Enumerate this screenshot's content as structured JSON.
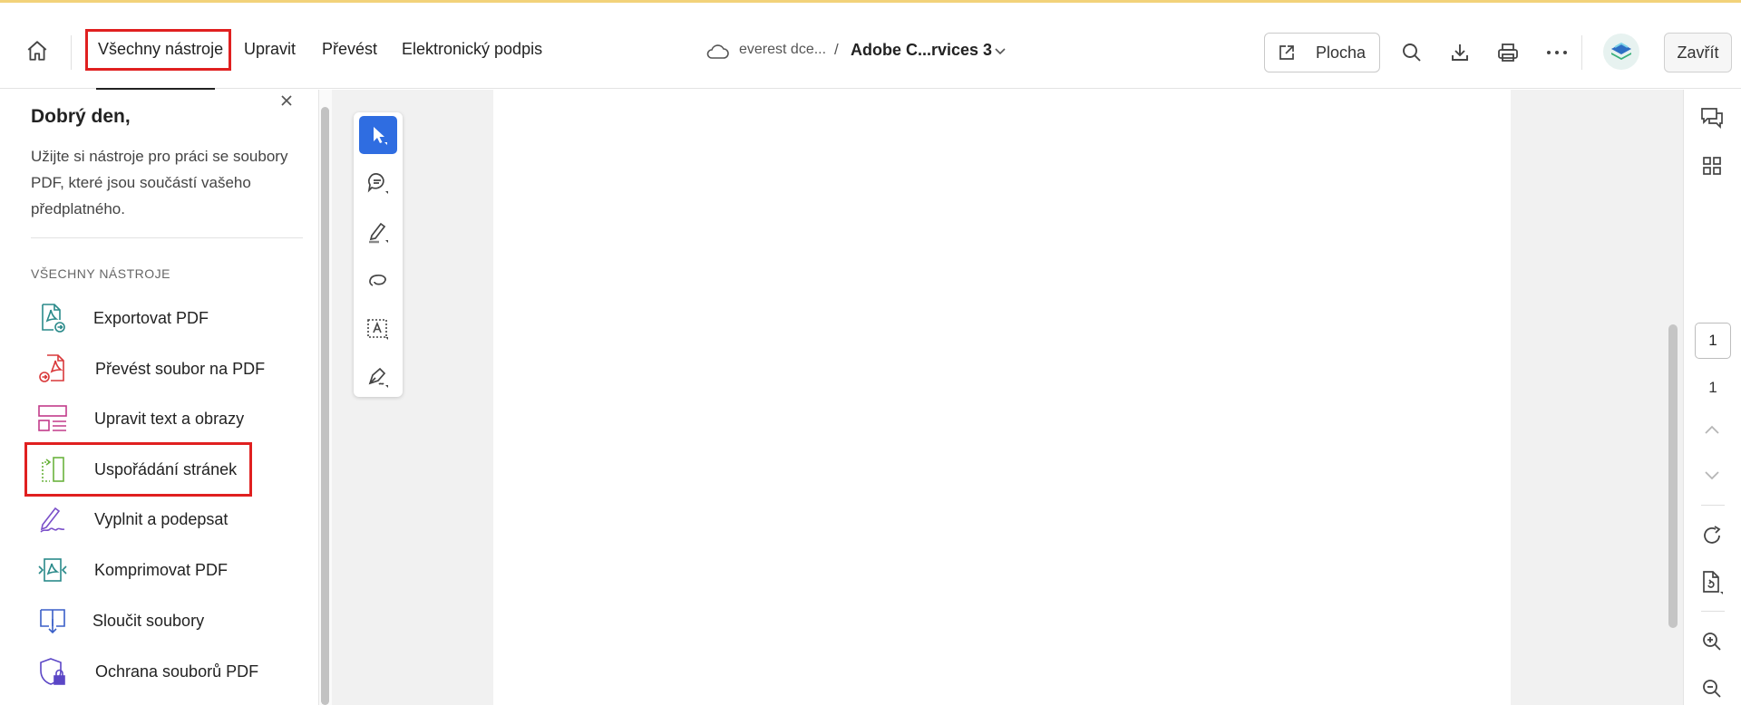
{
  "header": {
    "nav": [
      "Všechny nástroje",
      "Upravit",
      "Převést",
      "Elektronický podpis"
    ],
    "breadcrumb": {
      "folder": "everest dce...",
      "separator": "/",
      "document": "Adobe C...rvices 3"
    },
    "desktop_button_label": "Plocha",
    "close_button_label": "Zavřít"
  },
  "panel": {
    "greeting": "Dobrý den,",
    "intro": "Užijte si nástroje pro práci se soubory PDF, které jsou součástí vašeho předplatného.",
    "section_label": "VŠECHNY NÁSTROJE",
    "tools": [
      {
        "label": "Exportovat PDF",
        "icon": "export-pdf-icon",
        "color": "#2a8a8a"
      },
      {
        "label": "Převést soubor na PDF",
        "icon": "create-pdf-icon",
        "color": "#d9383a"
      },
      {
        "label": "Upravit text a obrazy",
        "icon": "edit-text-images-icon",
        "color": "#c23b8a"
      },
      {
        "label": "Uspořádání stránek",
        "icon": "organize-pages-icon",
        "color": "#6bb33e"
      },
      {
        "label": "Vyplnit a podepsat",
        "icon": "fill-sign-icon",
        "color": "#7a4fc9"
      },
      {
        "label": "Komprimovat PDF",
        "icon": "compress-pdf-icon",
        "color": "#2a8a8a"
      },
      {
        "label": "Sloučit soubory",
        "icon": "combine-files-icon",
        "color": "#3a5fc8"
      },
      {
        "label": "Ochrana souborů PDF",
        "icon": "protect-pdf-icon",
        "color": "#5b46c6"
      }
    ]
  },
  "page_nav": {
    "current_page": "1",
    "total_pages": "1"
  },
  "colors": {
    "accent": "#2f6de1",
    "highlight": "#e02020",
    "top_bar": "#f2d27a"
  }
}
